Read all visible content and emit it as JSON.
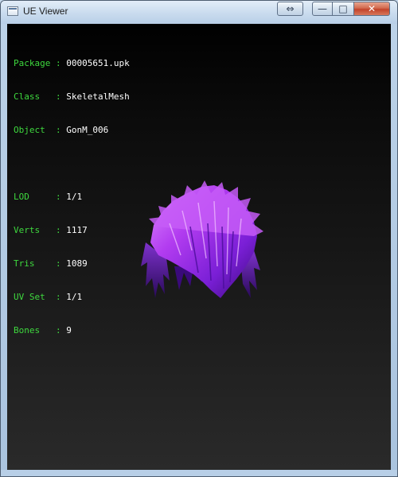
{
  "window": {
    "title": "UE Viewer"
  },
  "controls": {
    "swap_glyph": "⇔",
    "minimize_glyph": "—",
    "maximize_glyph": "□",
    "close_glyph": "✕"
  },
  "info": {
    "package": {
      "label": "Package",
      "value": "00005651.upk"
    },
    "class": {
      "label": "Class  ",
      "value": "SkeletalMesh"
    },
    "object": {
      "label": "Object ",
      "value": "GonM_006"
    },
    "lod": {
      "label": "LOD    ",
      "value": "1/1"
    },
    "verts": {
      "label": "Verts  ",
      "value": "1117"
    },
    "tris": {
      "label": "Tris   ",
      "value": "1089"
    },
    "uvset": {
      "label": "UV Set ",
      "value": "1/1"
    },
    "bones": {
      "label": "Bones  ",
      "value": "9"
    },
    "separator": " : "
  },
  "colors": {
    "label": "#3ed83e",
    "value": "#ffffff",
    "mesh_primary": "#b23cf0",
    "mesh_dark": "#3a0a7a"
  }
}
